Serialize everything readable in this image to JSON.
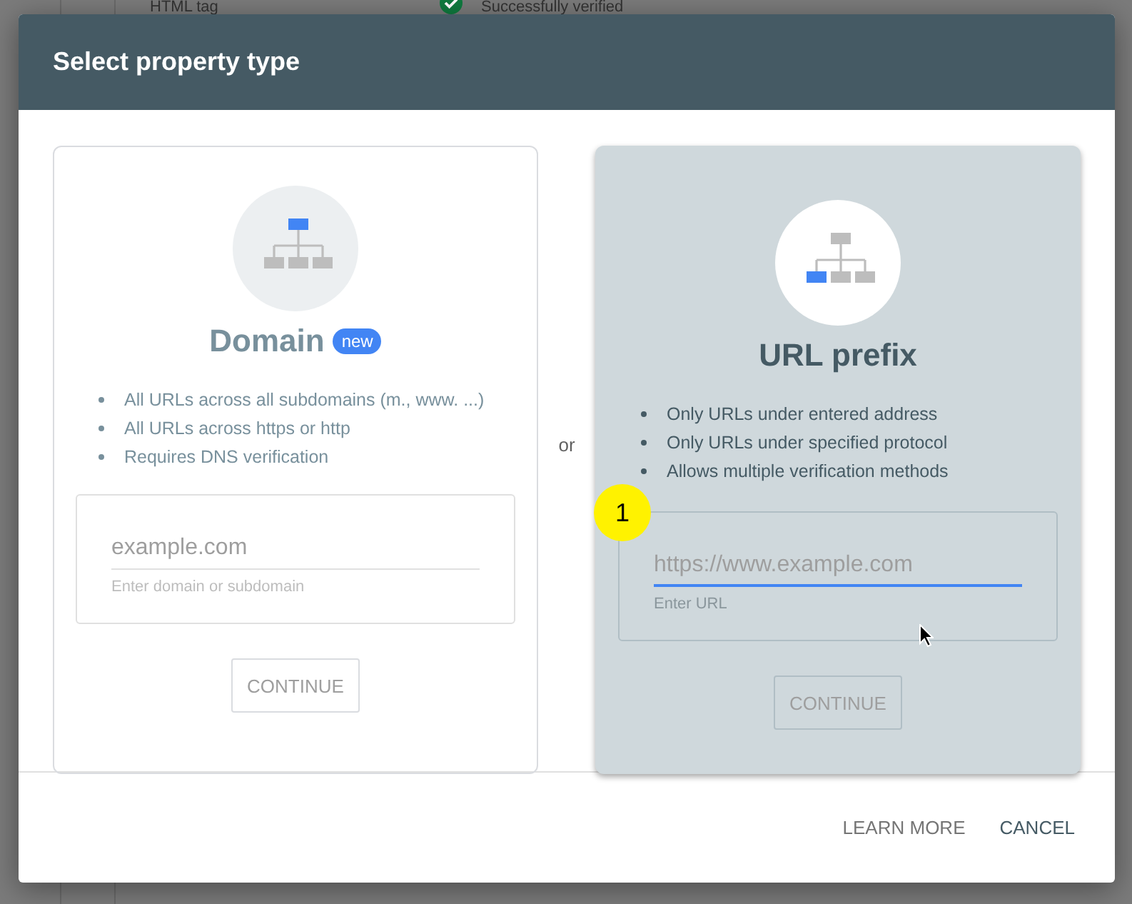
{
  "background": {
    "row": {
      "label": "HTML tag",
      "status": "Successfully verified"
    }
  },
  "dialog": {
    "title": "Select property type",
    "options": [
      {
        "kind": "domain",
        "title": "Domain",
        "badge": "new",
        "selected": false,
        "bullets": [
          "All URLs across all subdomains (m., www. ...)",
          "All URLs across https or http",
          "Requires DNS verification"
        ],
        "field": {
          "placeholder": "example.com",
          "helper": "Enter domain or subdomain",
          "focused": false
        },
        "button": "CONTINUE"
      },
      {
        "kind": "prefix",
        "title": "URL prefix",
        "selected": true,
        "step_marker": "1",
        "bullets": [
          "Only URLs under entered address",
          "Only URLs under specified protocol",
          "Allows multiple verification methods"
        ],
        "field": {
          "placeholder": "https://www.example.com",
          "helper": "Enter URL",
          "focused": true
        },
        "button": "CONTINUE"
      }
    ],
    "separator": "or",
    "actions": [
      "LEARN MORE",
      "CANCEL"
    ]
  }
}
